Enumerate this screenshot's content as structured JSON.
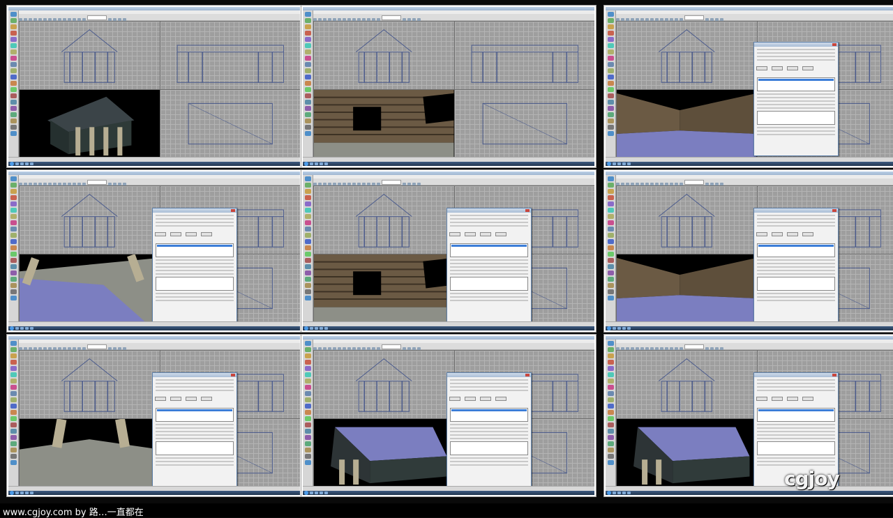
{
  "footer": {
    "caption": "www.cgjoy.com by 路…一直都在"
  },
  "watermark": {
    "logo": "cgjoy",
    "tagline": ""
  },
  "thumbnails": [
    {
      "id": "t1",
      "view": "exterior",
      "dialog": false,
      "accent": "#3a3a3a"
    },
    {
      "id": "t2",
      "view": "wall",
      "dialog": false,
      "accent": "#5a4a35"
    },
    {
      "id": "t3",
      "view": "room",
      "dialog": true,
      "accent": "#5a4a35"
    },
    {
      "id": "t4",
      "view": "floor",
      "dialog": true,
      "accent": "#7b7ec0"
    },
    {
      "id": "t5",
      "view": "wall",
      "dialog": true,
      "accent": "#5a4a35"
    },
    {
      "id": "t6",
      "view": "room",
      "dialog": true,
      "accent": "#5a4a35"
    },
    {
      "id": "t7",
      "view": "floor-dark",
      "dialog": true,
      "accent": "#8c8c88"
    },
    {
      "id": "t8",
      "view": "roof",
      "dialog": true,
      "accent": "#7b7ec0"
    },
    {
      "id": "t9",
      "view": "roof",
      "dialog": true,
      "accent": "#7b7ec0"
    }
  ],
  "colors": {
    "wireframe": "#4a5a8c",
    "stone": "#6b5a44",
    "tile_blue": "#7b7ec0",
    "tile_grey": "#8d8f87",
    "roof_dark": "#3b4448"
  }
}
